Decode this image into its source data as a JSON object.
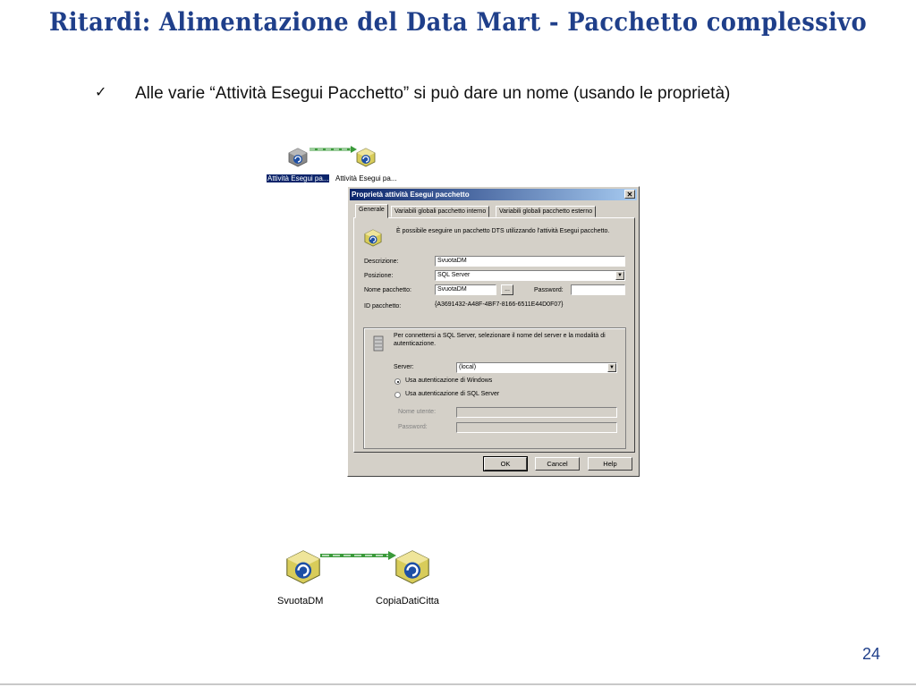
{
  "slide": {
    "title": "Ritardi: Alimentazione del Data Mart - Pacchetto complessivo",
    "bullet_check": "✓",
    "bullet": "Alle varie “Attività Esegui Pacchetto” si può dare un nome (usando le proprietà)",
    "page_number": "24"
  },
  "top_diagram": {
    "task1_label": "Attività Esegui pa...",
    "task2_label": "Attività Esegui pa..."
  },
  "dialog": {
    "title": "Proprietà attività Esegui pacchetto",
    "close": "✕",
    "tabs": [
      "Generale",
      "Variabili globali pacchetto interno",
      "Variabili globali pacchetto esterno"
    ],
    "intro": "È possibile eseguire un pacchetto DTS utilizzando l'attività Esegui pacchetto.",
    "descrizione_label": "Descrizione:",
    "descrizione_value": "SvuotaDM",
    "posizione_label": "Posizione:",
    "posizione_value": "SQL Server",
    "nome_pacchetto_label": "Nome pacchetto:",
    "nome_pacchetto_value": "SvuotaDM",
    "browse_button": "...",
    "password_label": "Password:",
    "password_value": "",
    "id_label": "ID pacchetto:",
    "id_value": "{A3691432-A48F-4BF7-8166-6511E44D0F07}",
    "server_intro": "Per connettersi a SQL Server, selezionare il nome del server e la modalità di autenticazione.",
    "server_label": "Server:",
    "server_value": "(local)",
    "radio_windows": "Usa autenticazione di Windows",
    "radio_sql": "Usa autenticazione di SQL Server",
    "nome_utente_label": "Nome utente:",
    "password2_label": "Password:",
    "ok": "OK",
    "cancel": "Cancel",
    "help": "Help"
  },
  "bottom_diagram": {
    "task1_label": "SvuotaDM",
    "task2_label": "CopiaDatiCitta"
  },
  "colors": {
    "title": "#1f3f8a",
    "dialog_bg": "#d4d0c8",
    "titlebar": "#0a246a",
    "precedence_arrow": "#3a9a3a"
  }
}
